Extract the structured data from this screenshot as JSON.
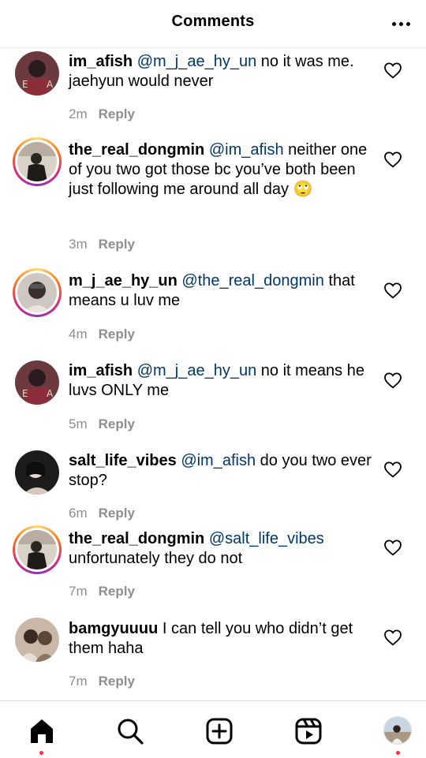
{
  "header": {
    "title": "Comments",
    "more_icon": "more-horizontal-icon"
  },
  "comments": [
    {
      "username": "im_afish",
      "mention": "@m_j_ae_hy_un",
      "text": " no it was me. jaehyun would never",
      "time": "2m",
      "reply": "Reply",
      "story_ring": false
    },
    {
      "username": "the_real_dongmin",
      "mention": "@im_afish",
      "text": " neither one of you two got those bc you’ve both been just following me around all day 🙄",
      "time": "3m",
      "reply": "Reply",
      "story_ring": true
    },
    {
      "username": "m_j_ae_hy_un",
      "mention": "@the_real_dongmin",
      "text": " that means u luv me",
      "time": "4m",
      "reply": "Reply",
      "story_ring": true
    },
    {
      "username": "im_afish",
      "mention": "@m_j_ae_hy_un",
      "text": " no it means he luvs ONLY me",
      "time": "5m",
      "reply": "Reply",
      "story_ring": false
    },
    {
      "username": "salt_life_vibes",
      "mention": "@im_afish",
      "text": " do you two ever stop?",
      "time": "6m",
      "reply": "Reply",
      "story_ring": false
    },
    {
      "username": "the_real_dongmin",
      "mention": "@salt_life_vibes",
      "text": " unfortunately they do not",
      "time": "7m",
      "reply": "Reply",
      "story_ring": true
    },
    {
      "username": "bamgyuuuu",
      "mention": "",
      "text": " I can tell you who didn’t get them haha",
      "time": "7m",
      "reply": "Reply",
      "story_ring": false
    }
  ],
  "colors": {
    "mention": "#00376b",
    "meta": "#8e8e8e",
    "notification_dot": "#ff3040"
  },
  "tabbar": {
    "home_icon": "home-icon",
    "search_icon": "search-icon",
    "create_icon": "create-plus-icon",
    "reels_icon": "reels-icon",
    "profile_icon": "profile-avatar"
  }
}
